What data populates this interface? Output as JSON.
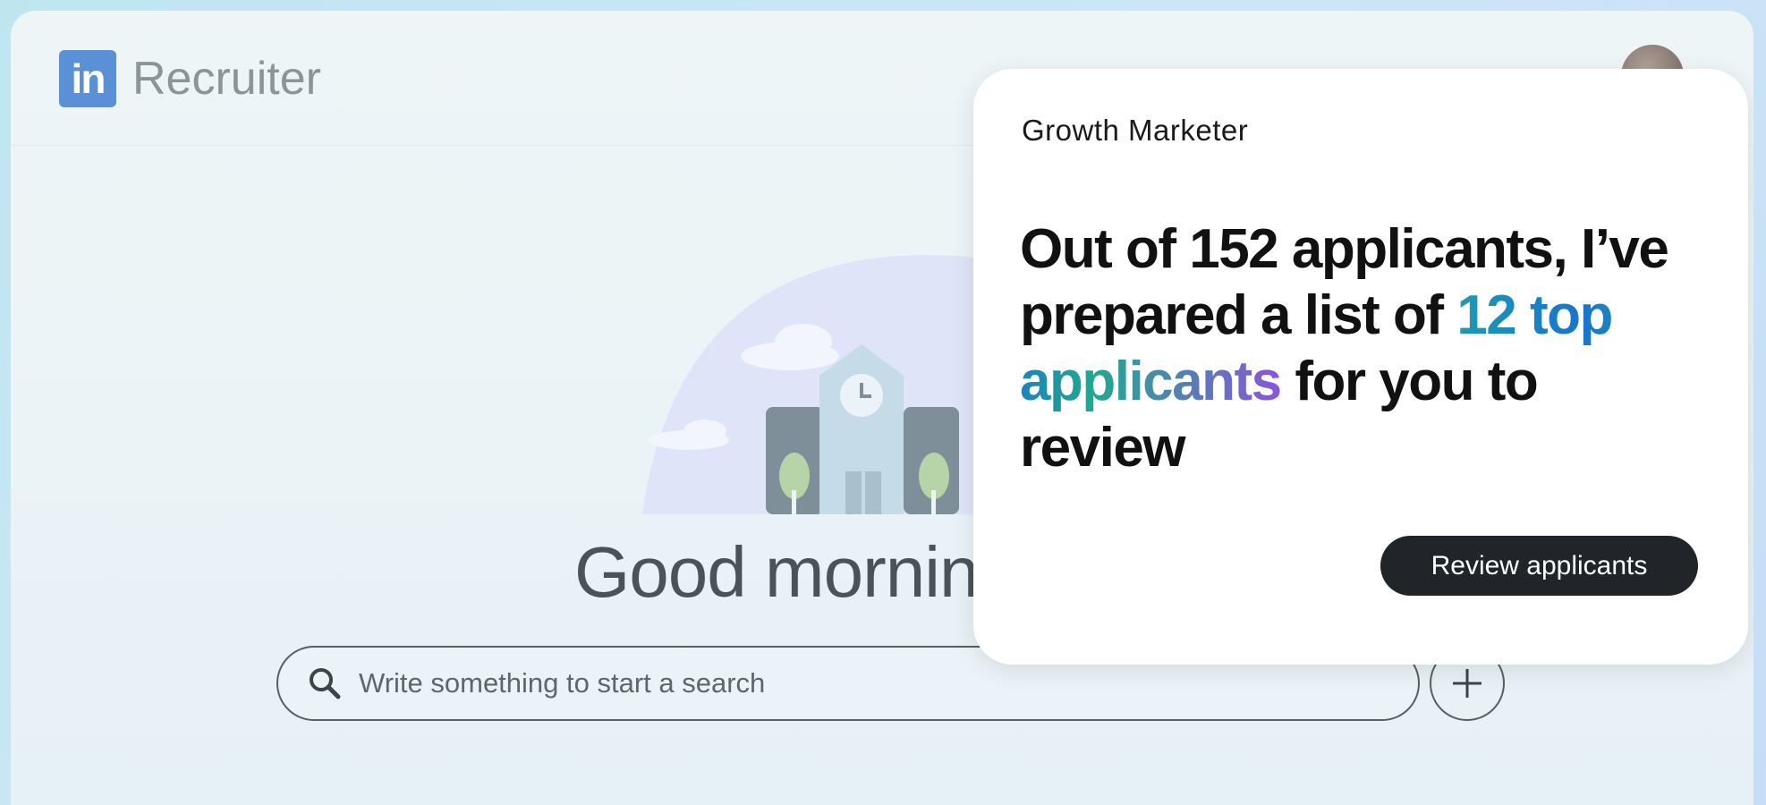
{
  "app": {
    "brand_mark": "in",
    "name": "Recruiter"
  },
  "home": {
    "greeting": "Good mornin",
    "search": {
      "placeholder": "Write something to start a search",
      "icon": "search-icon"
    },
    "add_icon": "plus-icon"
  },
  "popup": {
    "job_title": "Growth Marketer",
    "message_part1": "Out of 152 applicants, I’ve prepared a list of ",
    "highlight": "12 top applicants",
    "message_part2": " for you to review",
    "button_label": "Review applicants"
  },
  "colors": {
    "brand_blue": "#5b8fd6",
    "button_dark": "#212529",
    "gradient_start": "#1e9bb0",
    "gradient_end": "#8b55d8"
  }
}
